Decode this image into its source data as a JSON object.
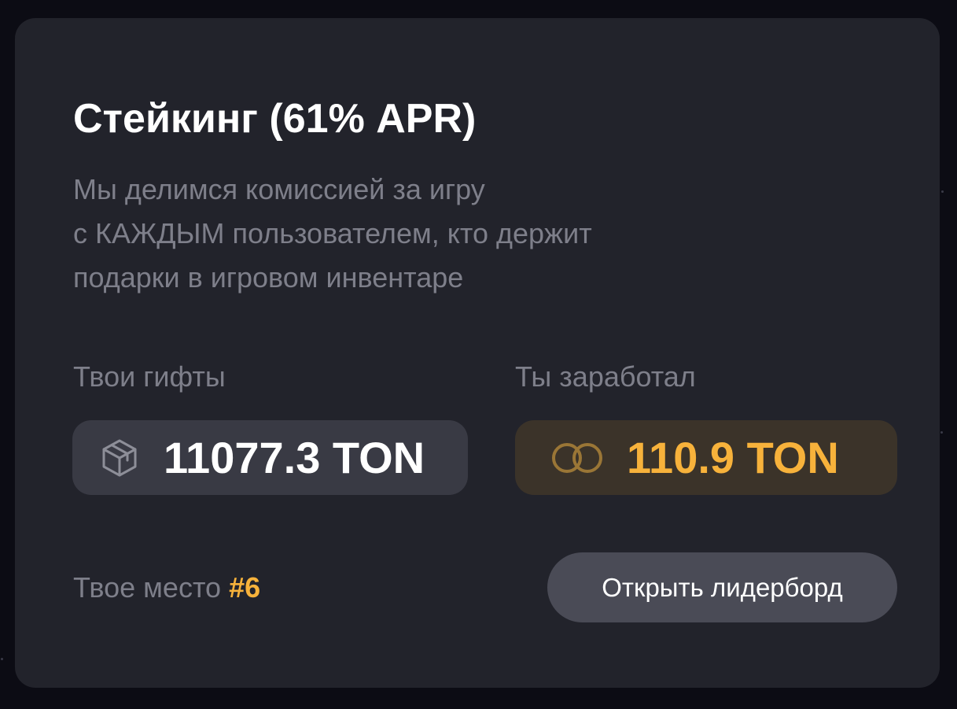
{
  "staking": {
    "title": "Стейкинг (61% APR)",
    "description_lines": [
      "Мы делимся комиссией за игру",
      "с КАЖДЫМ пользователем, кто держит",
      "подарки в игровом инвентаре"
    ]
  },
  "gifts": {
    "label": "Твои гифты",
    "value": "11077.3 TON",
    "icon": "box-icon"
  },
  "earned": {
    "label": "Ты заработал",
    "value": "110.9 TON",
    "icon": "coins-icon"
  },
  "rank": {
    "label": "Твое место",
    "value": "#6"
  },
  "leaderboard_button": {
    "label": "Открыть лидерборд"
  },
  "colors": {
    "background": "#0c0c14",
    "card": "#22232b",
    "accent": "#f7b23b",
    "muted_text": "#7e7f8a",
    "button": "#4a4b56"
  }
}
